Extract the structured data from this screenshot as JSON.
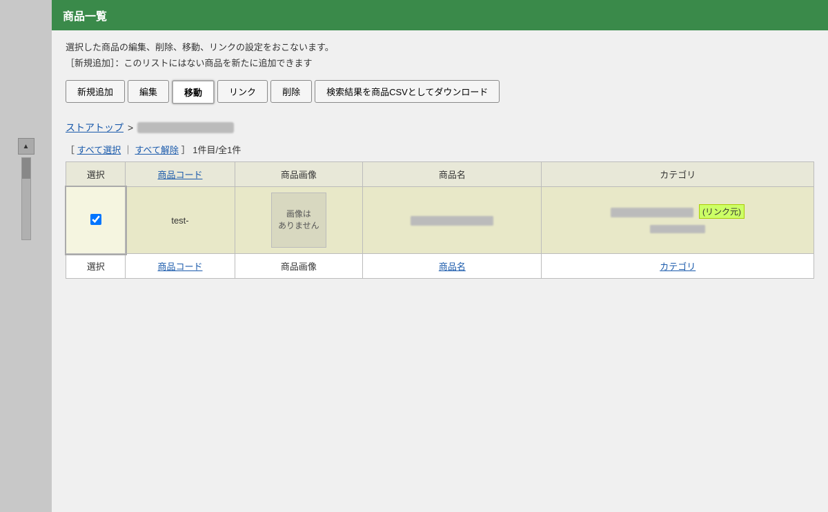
{
  "page": {
    "title": "商品一覧",
    "description_line1": "選択した商品の編集、削除、移動、リンクの設定をおこないます。",
    "description_line2": "［新規追加］：このリストにはない商品を新たに追加できます"
  },
  "toolbar": {
    "buttons": [
      {
        "id": "add",
        "label": "新規追加",
        "active": false
      },
      {
        "id": "edit",
        "label": "編集",
        "active": false
      },
      {
        "id": "move",
        "label": "移動",
        "active": true
      },
      {
        "id": "link",
        "label": "リンク",
        "active": false
      },
      {
        "id": "delete",
        "label": "削除",
        "active": false
      },
      {
        "id": "csv",
        "label": "検索結果を商品CSVとしてダウンロード",
        "active": false,
        "wide": true
      }
    ]
  },
  "breadcrumb": {
    "store_top_label": "ストアトップ",
    "separator": ">"
  },
  "table_controls": {
    "select_all_label": "すべて選択",
    "deselect_all_label": "すべて解除",
    "count_text": "1件目/全1件"
  },
  "table": {
    "headers": [
      {
        "id": "select",
        "label": "選択",
        "sortable": false
      },
      {
        "id": "code",
        "label": "商品コード",
        "sortable": true
      },
      {
        "id": "image",
        "label": "商品画像",
        "sortable": false
      },
      {
        "id": "name",
        "label": "商品名",
        "sortable": true
      },
      {
        "id": "category",
        "label": "カテゴリ",
        "sortable": true
      }
    ],
    "rows": [
      {
        "id": "row1",
        "selected": true,
        "code": "test-",
        "image_alt": "画像はありません",
        "name_blurred": true,
        "link_badge": "(リンク元)",
        "category_blurred": true,
        "has_link_badge": true
      }
    ],
    "no_image_text": "画像は\nありません"
  }
}
